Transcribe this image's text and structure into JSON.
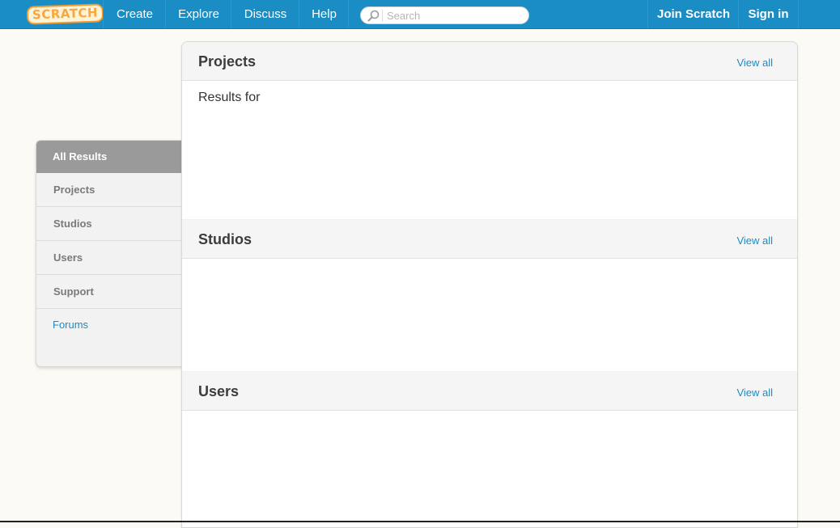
{
  "header": {
    "logo_text": "SCRATCH",
    "nav": {
      "create": "Create",
      "explore": "Explore",
      "discuss": "Discuss",
      "help": "Help"
    },
    "search": {
      "placeholder": "Search",
      "value": ""
    },
    "join": "Join Scratch",
    "signin": "Sign in"
  },
  "sidebar": {
    "items": [
      {
        "label": "All Results",
        "active": true
      },
      {
        "label": "Projects"
      },
      {
        "label": "Studios"
      },
      {
        "label": "Users"
      },
      {
        "label": "Support"
      }
    ],
    "forums_link": "Forums"
  },
  "main": {
    "projects": {
      "title": "Projects",
      "view_all": "View all",
      "results_text": "Results for"
    },
    "studios": {
      "title": "Studios",
      "view_all": "View all"
    },
    "users": {
      "title": "Users",
      "view_all": "View all"
    }
  },
  "colors": {
    "nav_bar": "#1a8dc5",
    "link": "#1a8dc5",
    "active_tab": "#9a9a9a",
    "page_background": "#fcfaf4"
  }
}
